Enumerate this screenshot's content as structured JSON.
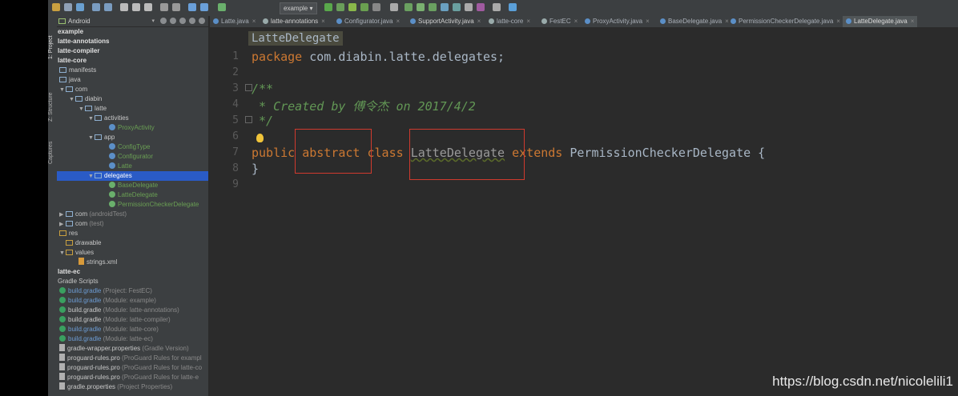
{
  "toolbar": {
    "run_config": "example"
  },
  "side_tabs": {
    "project": "1: Project",
    "structure": "Z: Structure",
    "captures": "Captures"
  },
  "project_panel": {
    "view_selector": "Android",
    "tree": [
      {
        "label": "example",
        "kind": "module"
      },
      {
        "label": "latte-annotations",
        "kind": "module"
      },
      {
        "label": "latte-compiler",
        "kind": "module"
      },
      {
        "label": "latte-core",
        "kind": "module"
      },
      {
        "label": "manifests",
        "kind": "folder"
      },
      {
        "label": "java",
        "kind": "folder"
      },
      {
        "label": "com",
        "kind": "folder"
      },
      {
        "label": "diabin",
        "kind": "folder"
      },
      {
        "label": "latte",
        "kind": "folder"
      },
      {
        "label": "activities",
        "kind": "folder"
      },
      {
        "label": "ProxyActivity",
        "kind": "class"
      },
      {
        "label": "app",
        "kind": "folder"
      },
      {
        "label": "ConfigType",
        "kind": "class"
      },
      {
        "label": "Configurator",
        "kind": "class"
      },
      {
        "label": "Latte",
        "kind": "class"
      },
      {
        "label": "delegates",
        "kind": "folder"
      },
      {
        "label": "BaseDelegate",
        "kind": "class"
      },
      {
        "label": "LatteDelegate",
        "kind": "class"
      },
      {
        "label": "PermissionCheckerDelegate",
        "kind": "class"
      },
      {
        "label": "com",
        "suffix": "(androidTest)",
        "kind": "folder"
      },
      {
        "label": "com",
        "suffix": "(test)",
        "kind": "folder"
      },
      {
        "label": "res",
        "kind": "folder"
      },
      {
        "label": "drawable",
        "kind": "folder"
      },
      {
        "label": "values",
        "kind": "folder"
      },
      {
        "label": "strings.xml",
        "kind": "file"
      },
      {
        "label": "latte-ec",
        "kind": "module"
      },
      {
        "label": "Gradle Scripts",
        "kind": "group"
      },
      {
        "label": "build.gradle",
        "suffix": "(Project: FestEC)",
        "kind": "gradle"
      },
      {
        "label": "build.gradle",
        "suffix": "(Module: example)",
        "kind": "gradle"
      },
      {
        "label": "build.gradle",
        "suffix": "(Module: latte-annotations)",
        "kind": "gradle"
      },
      {
        "label": "build.gradle",
        "suffix": "(Module: latte-compiler)",
        "kind": "gradle"
      },
      {
        "label": "build.gradle",
        "suffix": "(Module: latte-core)",
        "kind": "gradle"
      },
      {
        "label": "build.gradle",
        "suffix": "(Module: latte-ec)",
        "kind": "gradle"
      },
      {
        "label": "gradle-wrapper.properties",
        "suffix": "(Gradle Version)",
        "kind": "file"
      },
      {
        "label": "proguard-rules.pro",
        "suffix": "(ProGuard Rules for exampl",
        "kind": "file"
      },
      {
        "label": "proguard-rules.pro",
        "suffix": "(ProGuard Rules for latte-co",
        "kind": "file"
      },
      {
        "label": "proguard-rules.pro",
        "suffix": "(ProGuard Rules for latte-e",
        "kind": "file"
      },
      {
        "label": "gradle.properties",
        "suffix": "(Project Properties)",
        "kind": "file"
      }
    ]
  },
  "editor_tabs": [
    "Latte.java",
    "latte-annotations",
    "Configurator.java",
    "SupportActivity.java",
    "latte-core",
    "FestEC",
    "ProxyActivity.java",
    "BaseDelegate.java",
    "PermissionCheckerDelegate.java",
    "LatteDelegate.java"
  ],
  "editor": {
    "breadcrumb": "LatteDelegate",
    "line_numbers": [
      "1",
      "2",
      "3",
      "4",
      "5",
      "6",
      "7",
      "8",
      "9"
    ],
    "lines": {
      "l1_kw": "package",
      "l1_rest": " com.diabin.latte.delegates;",
      "l3": "/**",
      "l4": " * Created by 傅令杰 on 2017/4/2",
      "l5": " */",
      "l7_public": "public",
      "l7_abstract": "abstract",
      "l7_class": "class",
      "l7_name": "LatteDelegate",
      "l7_extends": "extends",
      "l7_rest": " PermissionCheckerDelegate {",
      "l8": "}"
    }
  },
  "watermark": "https://blog.csdn.net/nicolelili1"
}
